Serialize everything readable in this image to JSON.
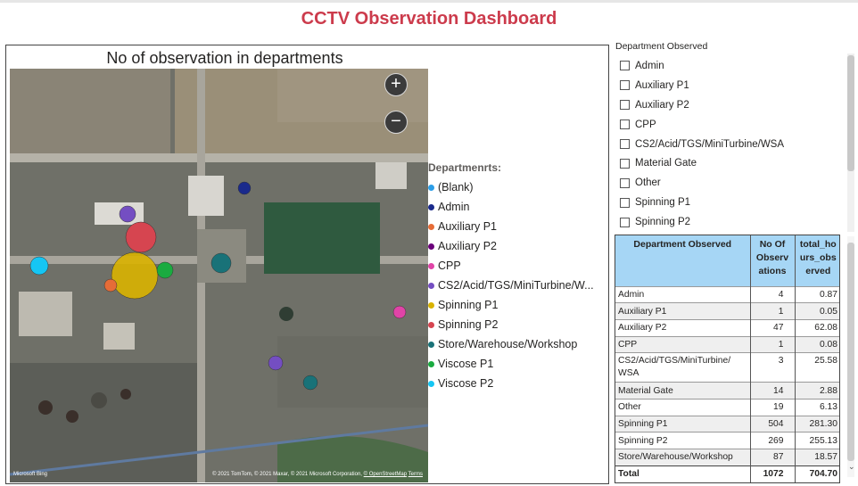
{
  "dashboard": {
    "title": "CCTV Observation Dashboard"
  },
  "map": {
    "title": "No of observation in departments",
    "zoom_in": "+",
    "zoom_out": "−",
    "logo": "Microsoft Bing",
    "attribution": "© 2021 TomTom, © 2021 Maxar, © 2021 Microsoft Corporation,",
    "attribution_link": "© OpenStreetMap",
    "terms": "Terms",
    "legend_title": "Departmenrts:",
    "legend": [
      {
        "label": "(Blank)",
        "color": "#2c9ee8"
      },
      {
        "label": "Admin",
        "color": "#1a2a8c"
      },
      {
        "label": "Auxiliary P1",
        "color": "#e66c37"
      },
      {
        "label": "Auxiliary P2",
        "color": "#6b007b"
      },
      {
        "label": "CPP",
        "color": "#e044a7"
      },
      {
        "label": "CS2/Acid/TGS/MiniTurbine/W...",
        "color": "#744ec2"
      },
      {
        "label": "Spinning P1",
        "color": "#d9b300"
      },
      {
        "label": "Spinning P2",
        "color": "#d64550"
      },
      {
        "label": "Store/Warehouse/Workshop",
        "color": "#197278"
      },
      {
        "label": "Viscose P1",
        "color": "#1aab40"
      },
      {
        "label": "Viscose P2",
        "color": "#15c6f4"
      }
    ],
    "bubble_colors": {
      "admin": "#1a2a8c",
      "cs2": "#744ec2",
      "spinning_p2": "#d64550",
      "spinning_p1": "#d9b300",
      "auxiliary_p1": "#e66c37",
      "viscose_p1": "#1aab40",
      "viscose_p2": "#15c6f4",
      "store": "#197278",
      "cpp": "#e044a7"
    }
  },
  "slicer": {
    "title": "Department Observed",
    "items": [
      "Admin",
      "Auxiliary P1",
      "Auxiliary P2",
      "CPP",
      "CS2/Acid/TGS/MiniTurbine/WSA",
      "Material Gate",
      "Other",
      "Spinning P1",
      "Spinning P2"
    ]
  },
  "table": {
    "headers": [
      "Department Observed",
      "No Of Observ ations",
      "total_ho urs_obs erved"
    ],
    "rows": [
      {
        "dept": "Admin",
        "obs": "4",
        "hours": "0.87"
      },
      {
        "dept": "Auxiliary P1",
        "obs": "1",
        "hours": "0.05"
      },
      {
        "dept": "Auxiliary P2",
        "obs": "47",
        "hours": "62.08"
      },
      {
        "dept": "CPP",
        "obs": "1",
        "hours": "0.08"
      },
      {
        "dept": "CS2/Acid/TGS/MiniTurbine/ WSA",
        "obs": "3",
        "hours": "25.58"
      },
      {
        "dept": "Material Gate",
        "obs": "14",
        "hours": "2.88"
      },
      {
        "dept": "Other",
        "obs": "19",
        "hours": "6.13"
      },
      {
        "dept": "Spinning P1",
        "obs": "504",
        "hours": "281.30"
      },
      {
        "dept": "Spinning P2",
        "obs": "269",
        "hours": "255.13"
      },
      {
        "dept": "Store/Warehouse/Workshop",
        "obs": "87",
        "hours": "18.57"
      }
    ],
    "total": {
      "label": "Total",
      "obs": "1072",
      "hours": "704.70"
    }
  }
}
